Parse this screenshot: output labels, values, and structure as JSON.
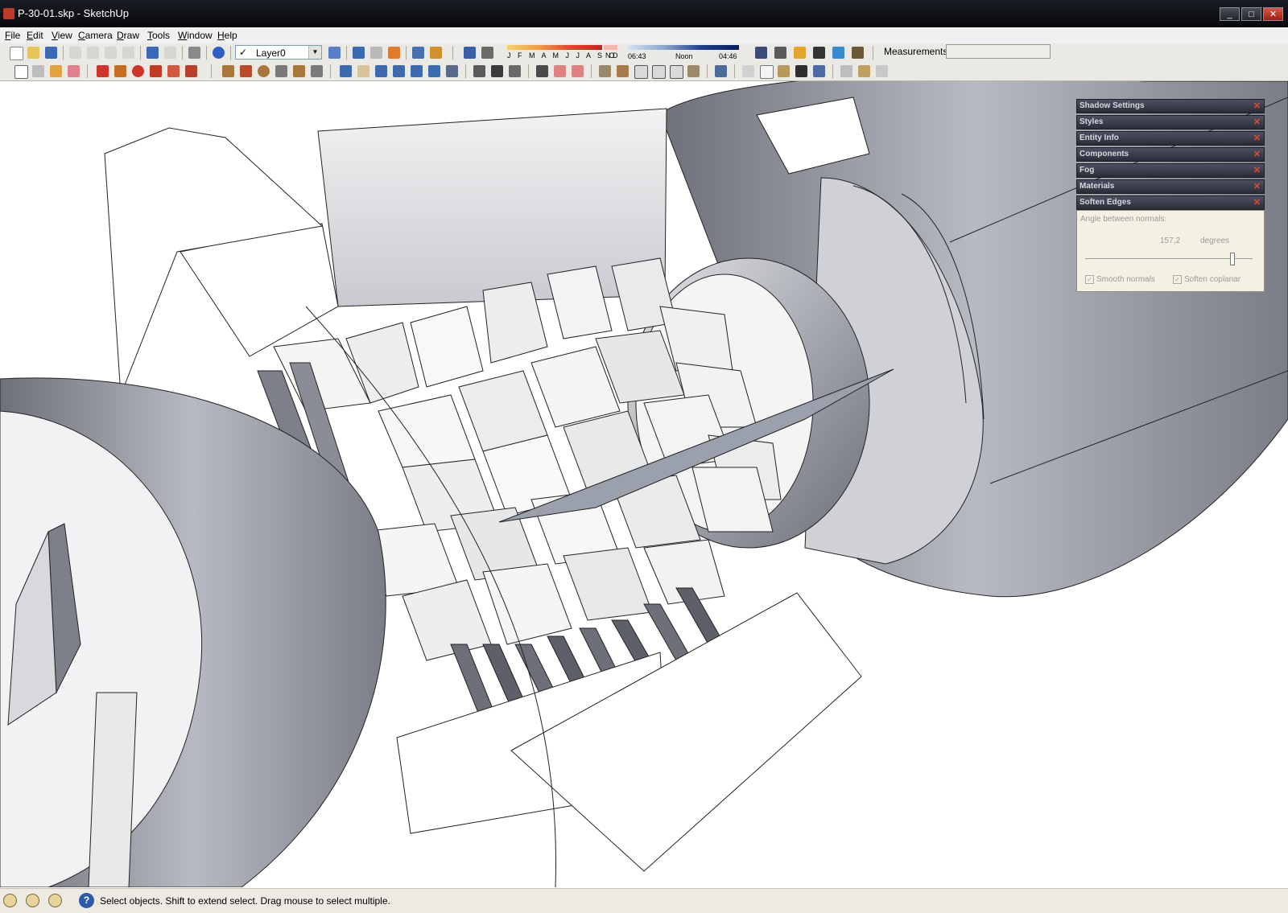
{
  "window": {
    "title": "P-30-01.skp - SketchUp",
    "minimize": "_",
    "restore": "□",
    "close": "✕"
  },
  "menu": [
    "File",
    "Edit",
    "View",
    "Camera",
    "Draw",
    "Tools",
    "Window",
    "Help"
  ],
  "layer": {
    "check": "✓",
    "name": "Layer0"
  },
  "shadow": {
    "months_label": "J F M A M J J A S O",
    "extra_months": "N D",
    "time_start": "06:43",
    "time_mid": "Noon",
    "time_end": "04:46"
  },
  "measurements": {
    "label": "Measurements",
    "value": ""
  },
  "trays": [
    {
      "label": "Shadow Settings",
      "close": "✕"
    },
    {
      "label": "Styles",
      "close": "✕"
    },
    {
      "label": "Entity Info",
      "close": "✕"
    },
    {
      "label": "Components",
      "close": "✕"
    },
    {
      "label": "Fog",
      "close": "✕"
    },
    {
      "label": "Materials",
      "close": "✕"
    },
    {
      "label": "Soften Edges",
      "close": "✕"
    }
  ],
  "soften_edges": {
    "angle_label": "Angle between normals:",
    "angle_value": "157,2",
    "angle_unit": "degrees",
    "angle_fraction": 0.873,
    "smooth_normals": "Smooth normals",
    "soften_coplanar": "Soften coplanar",
    "check": "✓"
  },
  "status": {
    "help": "?",
    "message": "Select objects. Shift to extend select. Drag mouse to select multiple."
  },
  "colors": {
    "titlebar": "#0f1116",
    "toolbar": "#ebe9e4",
    "tray_header": "#3a3e4b",
    "soften_body": "#f3f1e4"
  }
}
